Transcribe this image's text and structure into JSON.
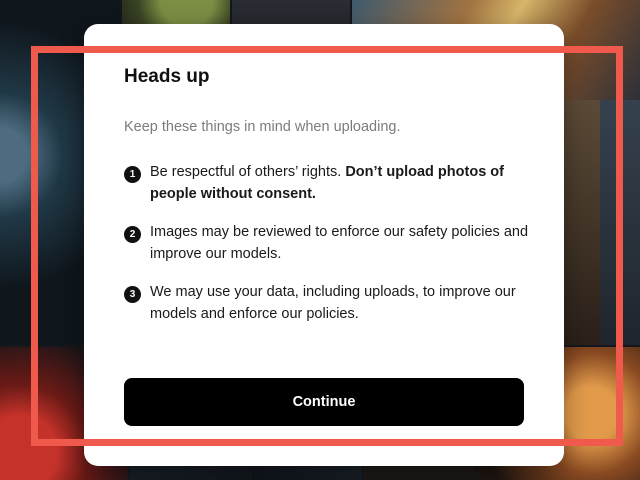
{
  "modal": {
    "title": "Heads up",
    "subtitle": "Keep these things in mind when uploading.",
    "items": [
      {
        "number": "1",
        "text": "Be respectful of others’ rights. ",
        "bold_text": "Don’t upload photos of people without consent."
      },
      {
        "number": "2",
        "text": "Images may be reviewed to enforce our safety policies and improve our models."
      },
      {
        "number": "3",
        "text": "We may use your data, including uploads, to improve our models and enforce our policies."
      }
    ],
    "continue_label": "Continue"
  },
  "colors": {
    "button_bg": "#000000",
    "highlight_border": "#f05a4d",
    "subtitle_text": "#7c7c7c"
  }
}
